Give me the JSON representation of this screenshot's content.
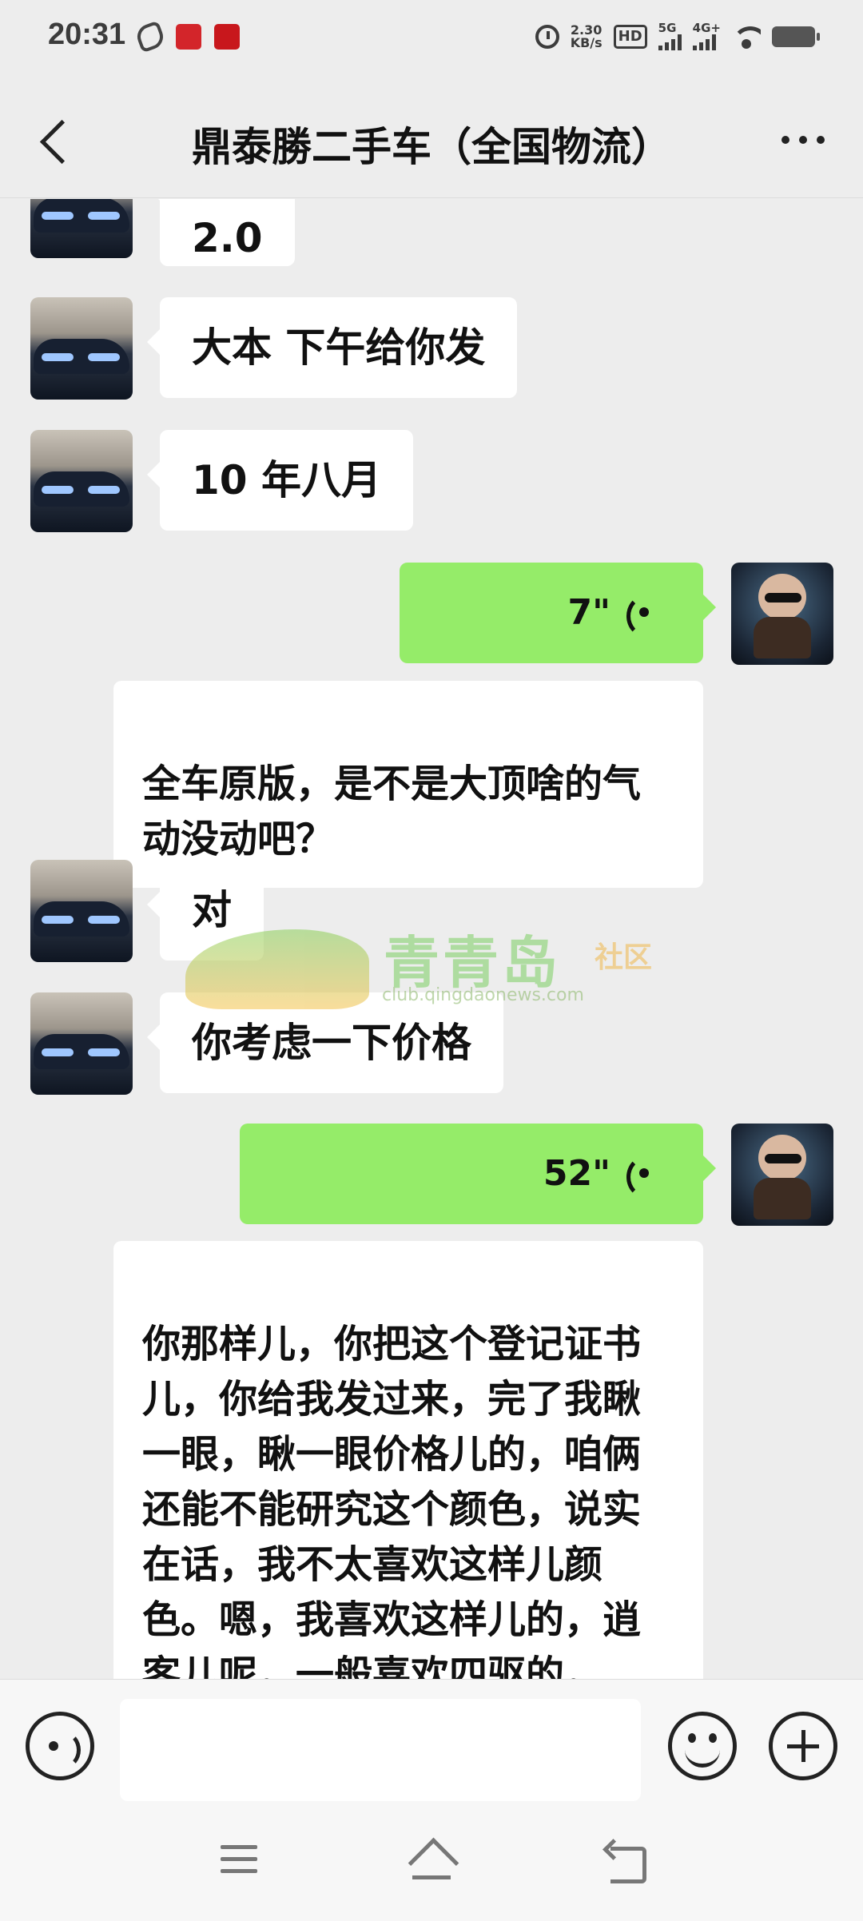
{
  "status_bar": {
    "time": "20:31",
    "net_speed_value": "2.30",
    "net_speed_unit": "KB/s",
    "hd_label": "HD",
    "sim1_label": "5G",
    "sim2_label": "4G+"
  },
  "header": {
    "title": "鼎泰勝二手车（全国物流）"
  },
  "messages": [
    {
      "side": "in",
      "type": "text",
      "text": "2.0"
    },
    {
      "side": "in",
      "type": "text",
      "text": "大本 下午给你发"
    },
    {
      "side": "in",
      "type": "text",
      "text": "10 年八月"
    },
    {
      "side": "out",
      "type": "voice",
      "duration": "7\""
    },
    {
      "side": "out",
      "type": "transcript",
      "text": "全车原版，是不是大顶啥的气动没动吧？"
    },
    {
      "side": "in",
      "type": "text",
      "text": "对"
    },
    {
      "side": "in",
      "type": "text",
      "text": "你考虑一下价格"
    },
    {
      "side": "out",
      "type": "voice",
      "duration": "52\""
    },
    {
      "side": "out",
      "type": "transcript",
      "text": "你那样儿，你把这个登记证书儿，你给我发过来，完了我瞅一眼，瞅一眼价格儿的，咱俩还能不能研究这个颜色，说实在话，我不太喜欢这样儿颜色。嗯，我喜欢这样儿的，逍客儿呢，一般喜欢四驱的，嗯，再就是啥呢，嗯，白色"
    }
  ],
  "watermark": {
    "brand": "青青岛",
    "sub": "社区",
    "url": "club.qingdaonews.com"
  },
  "input": {
    "value": "",
    "placeholder": ""
  },
  "colors": {
    "background": "#ededed",
    "outgoing_bubble": "#95ec69",
    "incoming_bubble": "#ffffff"
  }
}
